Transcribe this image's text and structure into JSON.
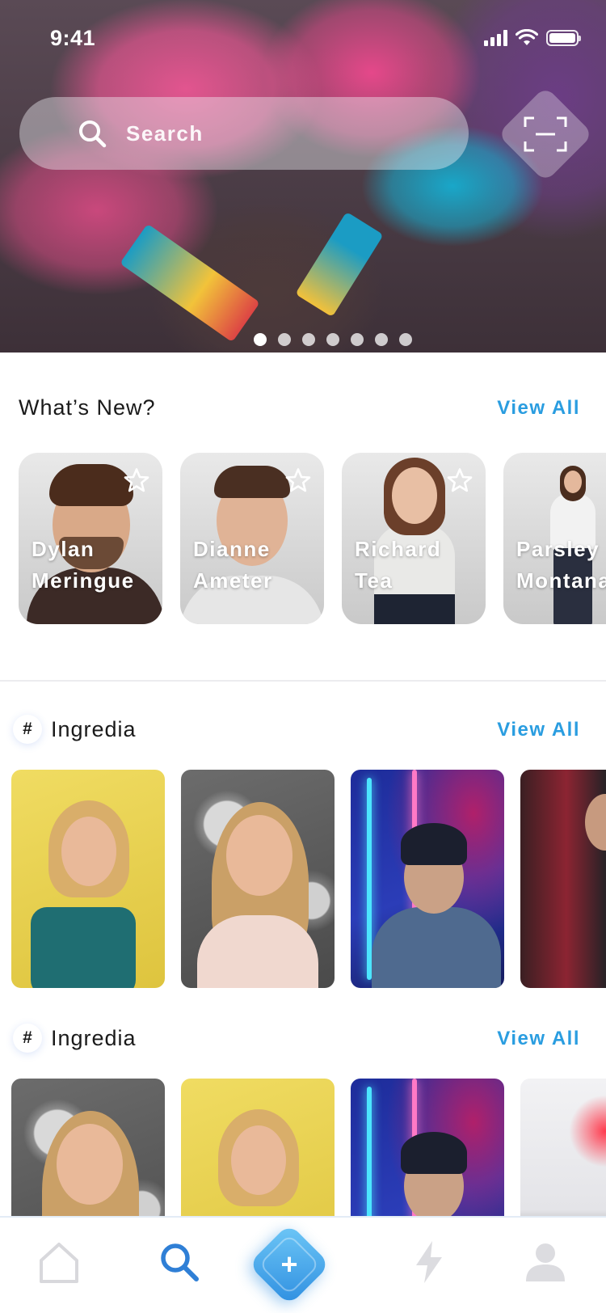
{
  "status_bar": {
    "time": "9:41"
  },
  "search": {
    "placeholder": "Search"
  },
  "hero": {
    "slide_count": 7,
    "active_slide": 1
  },
  "whats_new": {
    "title": "What’s New?",
    "view_all": "View All",
    "people": [
      {
        "first": "Dylan",
        "last": "Meringue"
      },
      {
        "first": "Dianne",
        "last": "Ameter"
      },
      {
        "first": "Richard",
        "last": "Tea"
      },
      {
        "first": "Parsley",
        "last": "Montana"
      }
    ]
  },
  "sections": [
    {
      "tag": "#",
      "title": "Ingredia",
      "view_all": "View All"
    },
    {
      "tag": "#",
      "title": "Ingredia",
      "view_all": "View All"
    }
  ],
  "tabbar": {
    "items": [
      "home-icon",
      "search-icon",
      "add-icon",
      "flash-icon",
      "profile-icon"
    ],
    "active": "search-icon",
    "accent": "#2a9de0",
    "inactive_color": "#d8d8dc"
  }
}
